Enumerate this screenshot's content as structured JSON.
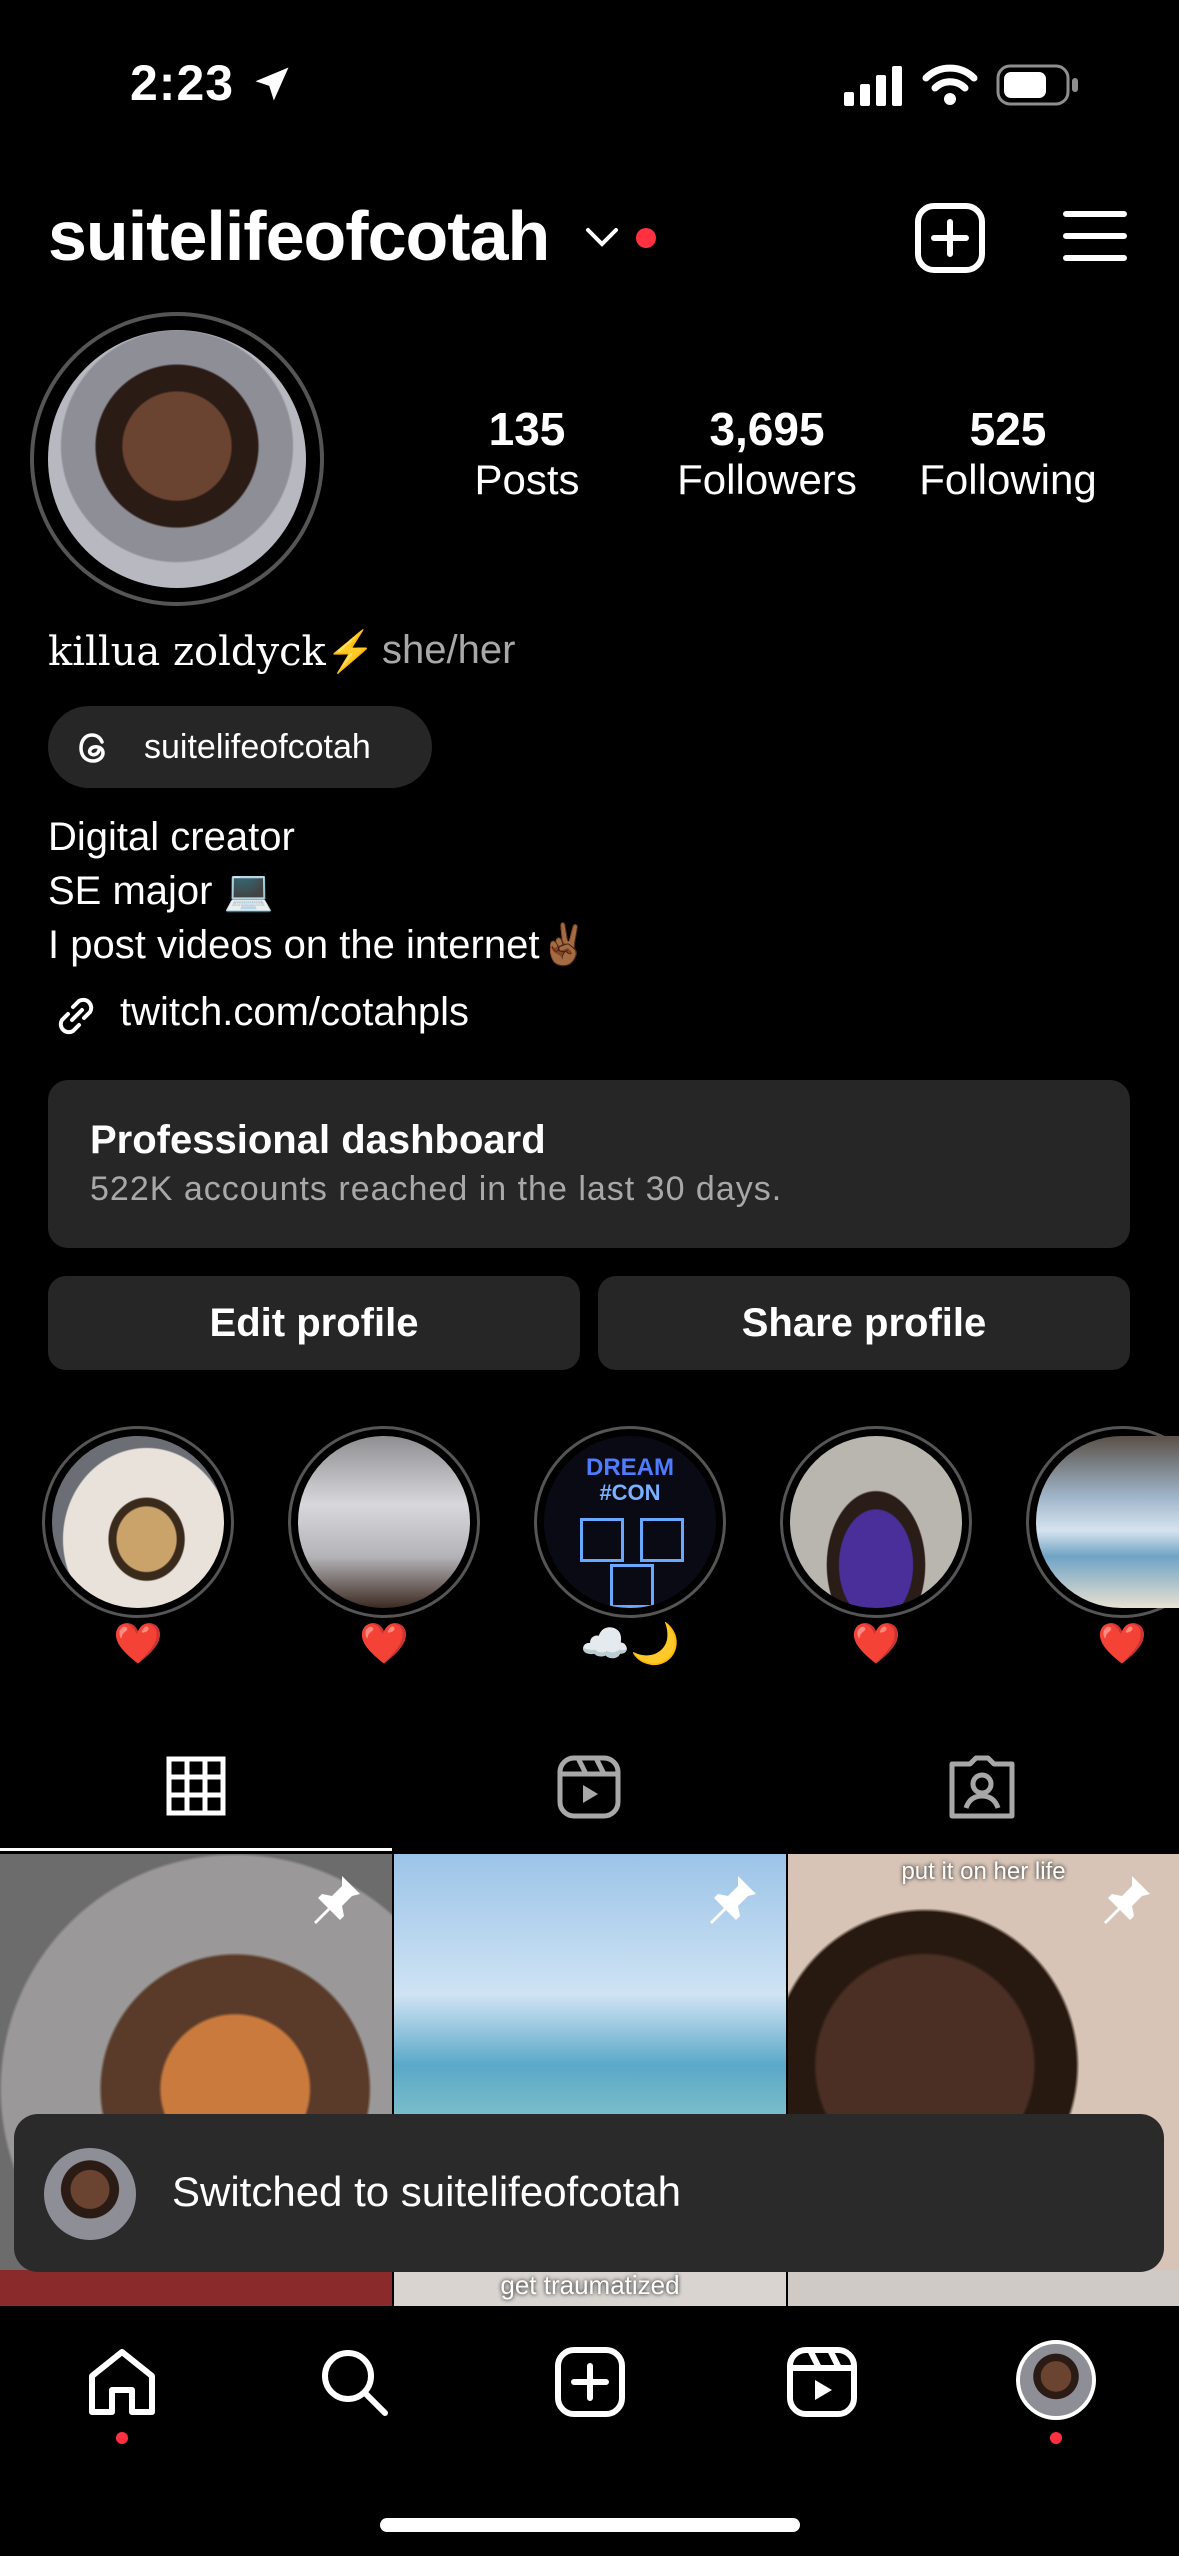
{
  "status_bar": {
    "time": "2:23"
  },
  "header": {
    "username": "suitelifeofcotah"
  },
  "stats": [
    {
      "value": "135",
      "label": "Posts"
    },
    {
      "value": "3,695",
      "label": "Followers"
    },
    {
      "value": "525",
      "label": "Following"
    }
  ],
  "profile": {
    "name": "killua zoldyck⚡️",
    "pronouns": "she/her",
    "threads_handle": "suitelifeofcotah",
    "bio_lines": [
      "Digital creator",
      "SE major 💻",
      "I post videos on the internet✌🏾"
    ],
    "link": "twitch.com/cotahpls"
  },
  "dashboard": {
    "title": "Professional dashboard",
    "subtitle": "522K accounts reached in the last 30 days."
  },
  "buttons": {
    "edit": "Edit profile",
    "share": "Share profile"
  },
  "highlights": [
    {
      "caption": "❤️"
    },
    {
      "caption": "❤️"
    },
    {
      "caption": "☁️🌙",
      "cover_title": "DREAM",
      "cover_sub": "#CON"
    },
    {
      "caption": "❤️"
    },
    {
      "caption": "❤️"
    }
  ],
  "tabs": [
    "grid",
    "reels",
    "tagged"
  ],
  "posts": [
    {
      "pinned": true,
      "overlay_text": ""
    },
    {
      "pinned": true,
      "overlay_text": ""
    },
    {
      "pinned": true,
      "overlay_text": "put it on her life"
    }
  ],
  "posts_row2": [
    {
      "overlay_text": ""
    },
    {
      "overlay_text": "get traumatized"
    },
    {
      "overlay_text": ""
    }
  ],
  "toast": {
    "text": "Switched to suitelifeofcotah"
  },
  "colors": {
    "accent_red": "#ff3040",
    "surface": "#262626",
    "secondary_text": "#a8a8a8"
  }
}
